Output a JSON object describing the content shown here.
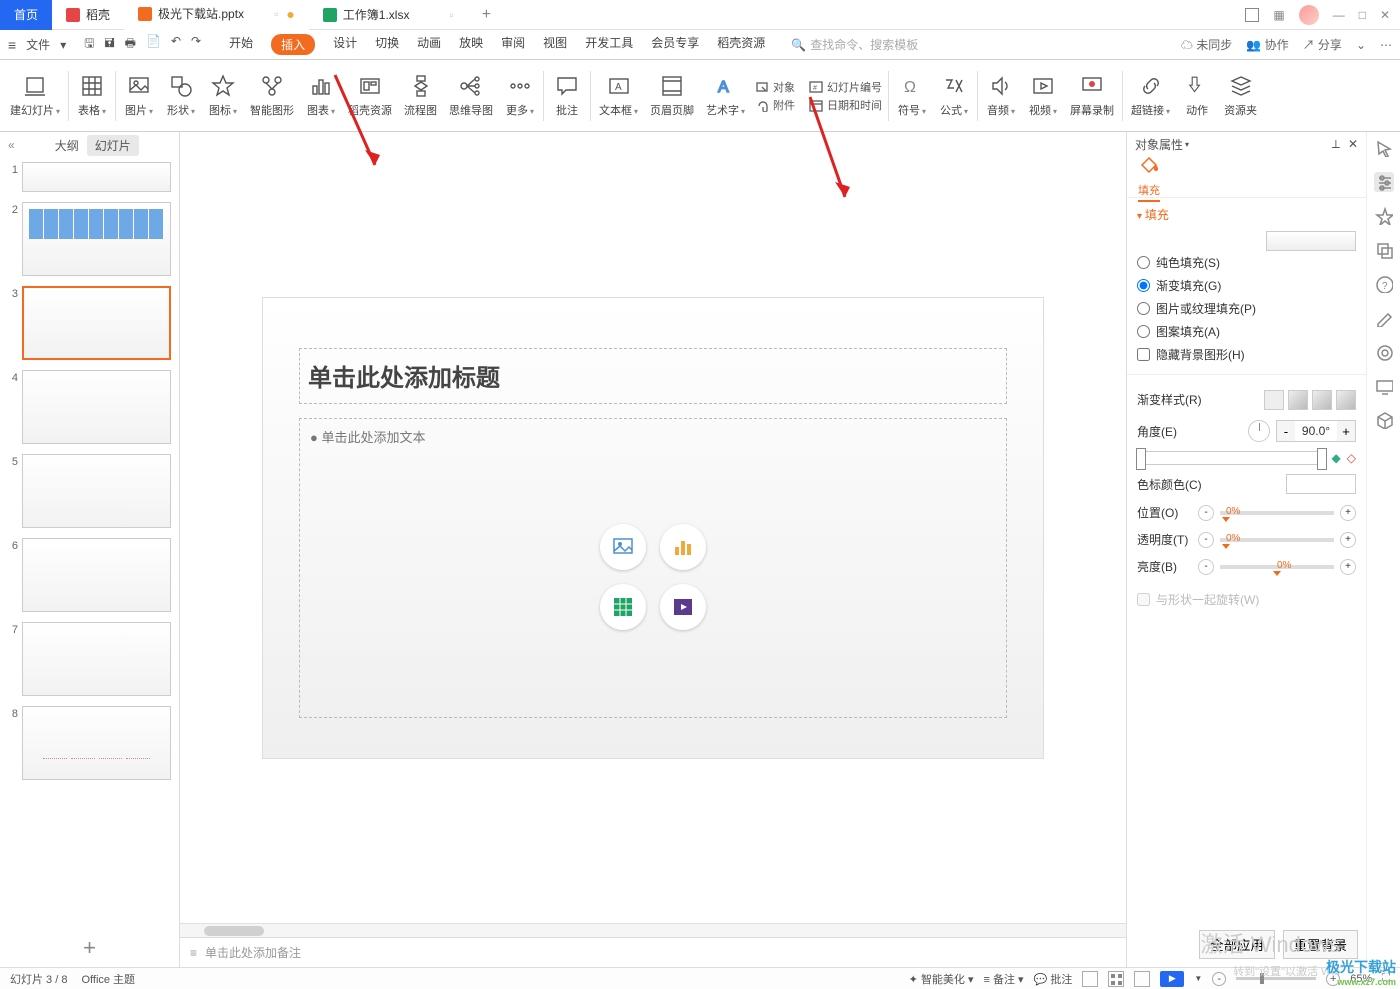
{
  "tabs": {
    "home": "首页",
    "docke": "稻壳",
    "file1": "极光下载站.pptx",
    "file2": "工作簿1.xlsx"
  },
  "winctl": {
    "min": "—",
    "max": "□",
    "close": "✕"
  },
  "menu": {
    "file": "文件",
    "dropdown": "▾",
    "items": [
      "开始",
      "插入",
      "设计",
      "切换",
      "动画",
      "放映",
      "审阅",
      "视图",
      "开发工具",
      "会员专享",
      "稻壳资源"
    ],
    "selectedIndex": 1,
    "searchPh": "查找命令、搜索模板",
    "sync": "未同步",
    "collab": "协作",
    "share": "分享"
  },
  "ribbon": {
    "items": [
      "建幻灯片",
      "表格",
      "图片",
      "形状",
      "图标",
      "智能图形",
      "图表",
      "稻壳资源",
      "流程图",
      "思维导图",
      "更多",
      "批注",
      "文本框",
      "页眉页脚",
      "艺术字",
      "",
      "",
      "",
      "",
      "符号",
      "公式",
      "",
      "音频",
      "视频",
      "屏幕录制",
      "",
      "超链接",
      "动作",
      "资源夹"
    ],
    "mini": {
      "obj": "对象",
      "attach": "附件",
      "slidenum": "幻灯片编号",
      "datetime": "日期和时间"
    }
  },
  "thumbs": {
    "collapse": "«",
    "tab1": "大纲",
    "tab2": "幻灯片",
    "nums": [
      "1",
      "2",
      "3",
      "4",
      "5",
      "6",
      "7",
      "8"
    ],
    "add": "+"
  },
  "slide": {
    "title": "单击此处添加标题",
    "body": "● 单击此处添加文本"
  },
  "notes": {
    "ph": "单击此处添加备注"
  },
  "rpanel": {
    "title": "对象属性",
    "pin": "⟂",
    "close": "✕",
    "fillTab": "填充",
    "section": "填充",
    "r_solid": "纯色填充(S)",
    "r_grad": "渐变填充(G)",
    "r_pic": "图片或纹理填充(P)",
    "r_patt": "图案填充(A)",
    "chk_hide": "隐藏背景图形(H)",
    "grad_style": "渐变样式(R)",
    "angle": "角度(E)",
    "angle_val": "90.0°",
    "stop_color": "色标颜色(C)",
    "pos": "位置(O)",
    "pos_val": "0%",
    "trans": "透明度(T)",
    "trans_val": "0%",
    "bright": "亮度(B)",
    "bright_val": "0%",
    "rotate": "与形状一起旋转(W)",
    "apply_all": "全部应用",
    "reset": "重置背景"
  },
  "status": {
    "slide": "幻灯片 3 / 8",
    "theme": "Office 主题",
    "smart": "智能美化",
    "notes": "备注",
    "comment": "批注",
    "zoom": "65%",
    "plus": "+",
    "minus": "-"
  },
  "wm": {
    "a": "激活 Windows",
    "b": "转到\"设置\"以激活 Win"
  },
  "logo": {
    "a": "极光下载站",
    "b": "www.xz7.com"
  }
}
